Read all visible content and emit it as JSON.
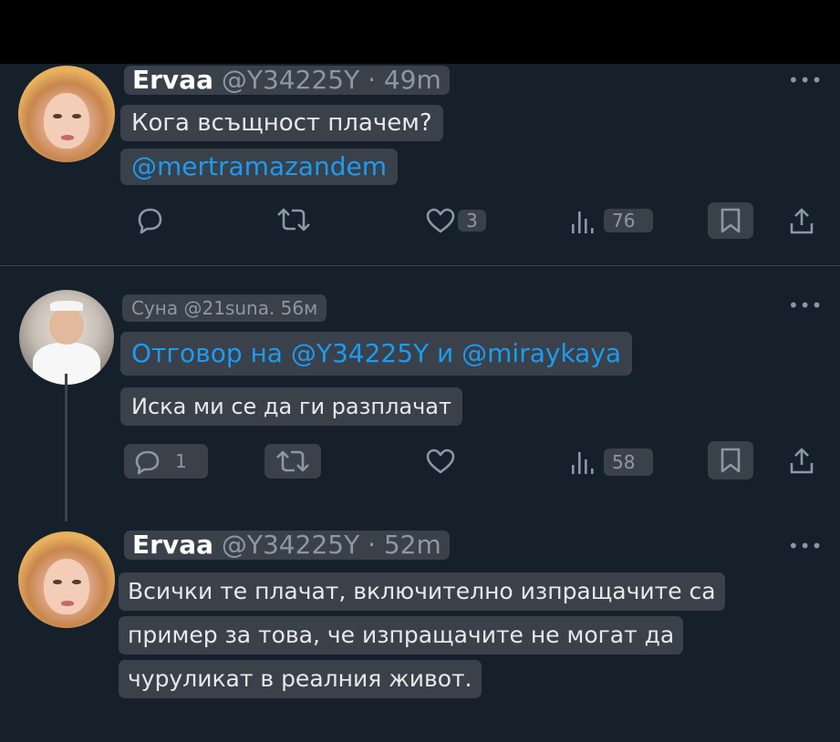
{
  "tweets": [
    {
      "display_name": "Ervaa",
      "handle_time": "@Y34225Y · 49m",
      "body": "Кога всъщност плачем?",
      "mention": "@mertramazandem",
      "stats": {
        "replies": "",
        "retweets": "",
        "likes": "3",
        "views": "76"
      }
    },
    {
      "handle_time": "Суна @21suna. 56м",
      "reply_to": "Отговор на @Y34225Y и @miraykaya",
      "body": "Иска ми се да ги разплачат",
      "stats": {
        "replies": "1",
        "retweets": "",
        "likes": "",
        "views": "58"
      }
    },
    {
      "display_name": "Ervaa",
      "handle_time": "@Y34225Y · 52m",
      "body_lines": [
        "Всички те плачат, включително изпращачите са",
        "пример за това, че изпращачите не могат да",
        "чуруликат в реалния живот."
      ]
    }
  ],
  "icons": [
    "more-icon",
    "reply-icon",
    "retweet-icon",
    "like-icon",
    "views-icon",
    "bookmark-icon",
    "share-icon"
  ],
  "colors": {
    "background": "#15202b",
    "bubble": "#3a414b",
    "mention": "#1d9bf0",
    "muted": "#8b98a5"
  }
}
